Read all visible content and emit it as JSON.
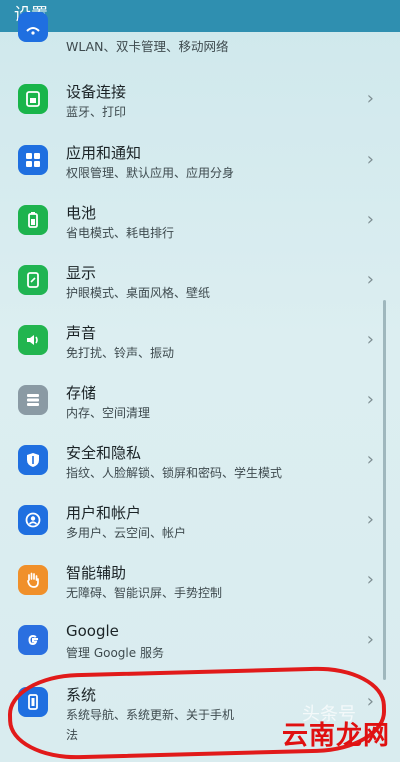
{
  "header": {
    "title": "设置"
  },
  "top_partial": {
    "subtitle": "WLAN、双卡管理、移动网络"
  },
  "items": [
    {
      "title": "设备连接",
      "subtitle": "蓝牙、打印",
      "icon": "device-connect-icon",
      "color": "#19b54a"
    },
    {
      "title": "应用和通知",
      "subtitle": "权限管理、默认应用、应用分身",
      "icon": "apps-grid-icon",
      "color": "#1f6fe0"
    },
    {
      "title": "电池",
      "subtitle": "省电模式、耗电排行",
      "icon": "battery-icon",
      "color": "#1db34e"
    },
    {
      "title": "显示",
      "subtitle": "护眼模式、桌面风格、壁纸",
      "icon": "display-icon",
      "color": "#20b452"
    },
    {
      "title": "声音",
      "subtitle": "免打扰、铃声、振动",
      "icon": "speaker-icon",
      "color": "#22b54f"
    },
    {
      "title": "存储",
      "subtitle": "内存、空间清理",
      "icon": "storage-icon",
      "color": "#8a9aa4"
    },
    {
      "title": "安全和隐私",
      "subtitle": "指纹、人脸解锁、锁屏和密码、学生模式",
      "icon": "shield-icon",
      "color": "#1f6fe0"
    },
    {
      "title": "用户和帐户",
      "subtitle": "多用户、云空间、帐户",
      "icon": "user-icon",
      "color": "#1f6fe0"
    },
    {
      "title": "智能辅助",
      "subtitle": "无障碍、智能识屏、手势控制",
      "icon": "hand-icon",
      "color": "#f0902a"
    },
    {
      "title": "Google",
      "subtitle": "管理 Google 服务",
      "icon": "google-g-icon",
      "color": "#2a6fe0"
    },
    {
      "title": "系统",
      "subtitle": "系统导航、系统更新、关于手机",
      "subtitle2": "法",
      "icon": "system-phone-icon",
      "color": "#1f6fe0"
    }
  ],
  "watermark": {
    "text": "云南龙网"
  },
  "chevron": "›"
}
